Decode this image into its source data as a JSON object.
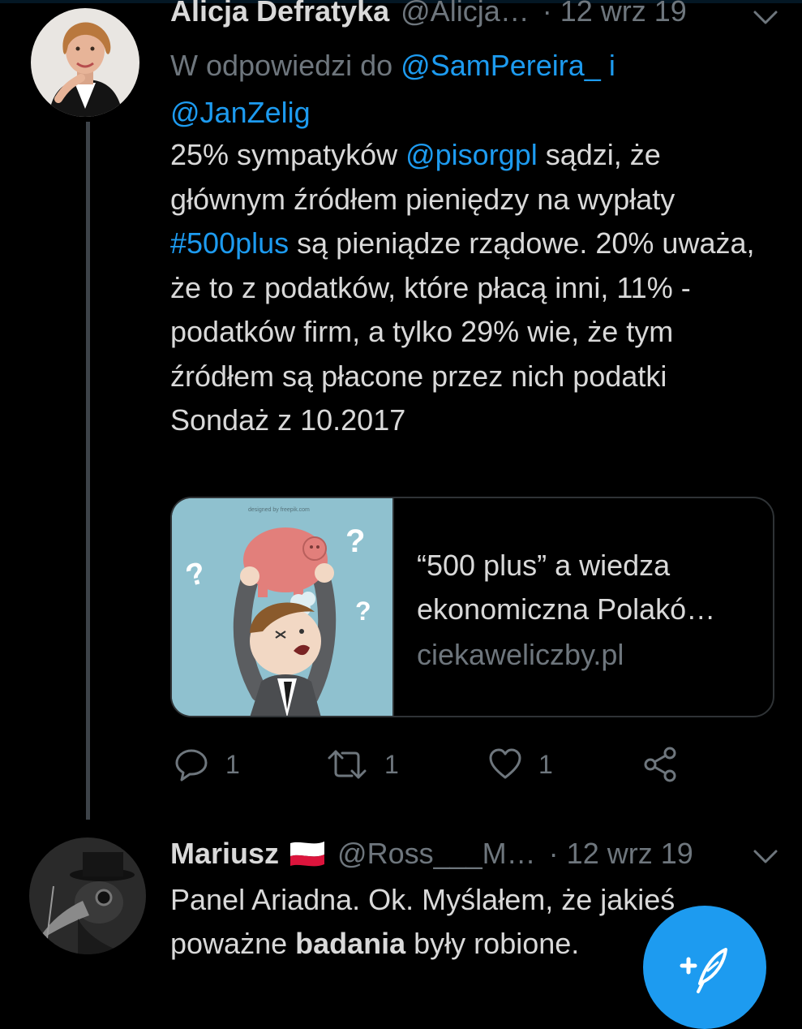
{
  "tweets": [
    {
      "display_name": "Alicja Defratyka",
      "handle": "@Alicja…",
      "separator": "·",
      "date": "12 wrz 19",
      "reply_to": {
        "prefix": "W odpowiedzi do",
        "user1": "@SamPereira_",
        "joiner": "i",
        "user2": "@JanZelig"
      },
      "body": {
        "t1": "25% sympatyków ",
        "mention": "@pisorgpl",
        "t2": " sądzi, że głównym źródłem pieniędzy na wypłaty ",
        "hashtag": "#500plus",
        "t3": " są pieniądze rządowe. 20% uważa, że to z podatków, które płacą inni, 11% - podatków firm, a tylko 29% wie, że tym źródłem są płacone przez nich podatki",
        "t4": "Sondaż z 10.2017"
      },
      "card": {
        "watermark": "designed by freepik.com",
        "title_line1": "“500 plus” a wiedza",
        "title_line2": "ekonomiczna Polakó…",
        "domain": "ciekaweliczby.pl"
      },
      "actions": {
        "reply_count": "1",
        "retweet_count": "1",
        "like_count": "1"
      }
    },
    {
      "display_name": "Mariusz",
      "flag": "poland-flag",
      "handle": "@Ross___M…",
      "separator": "·",
      "date": "12 wrz 19",
      "body": {
        "t1": "Panel Ariadna. Ok. Myślałem, że jakieś poważne ",
        "bold": "badania",
        "t2": " były robione."
      }
    }
  ],
  "colors": {
    "background": "#000000",
    "text": "#d9d9d9",
    "secondary": "#6e767d",
    "accent": "#1d9bf0",
    "border": "#2f3336"
  },
  "icons": [
    "reply-icon",
    "retweet-icon",
    "like-icon",
    "share-icon",
    "chevron-down-icon",
    "compose-icon"
  ]
}
